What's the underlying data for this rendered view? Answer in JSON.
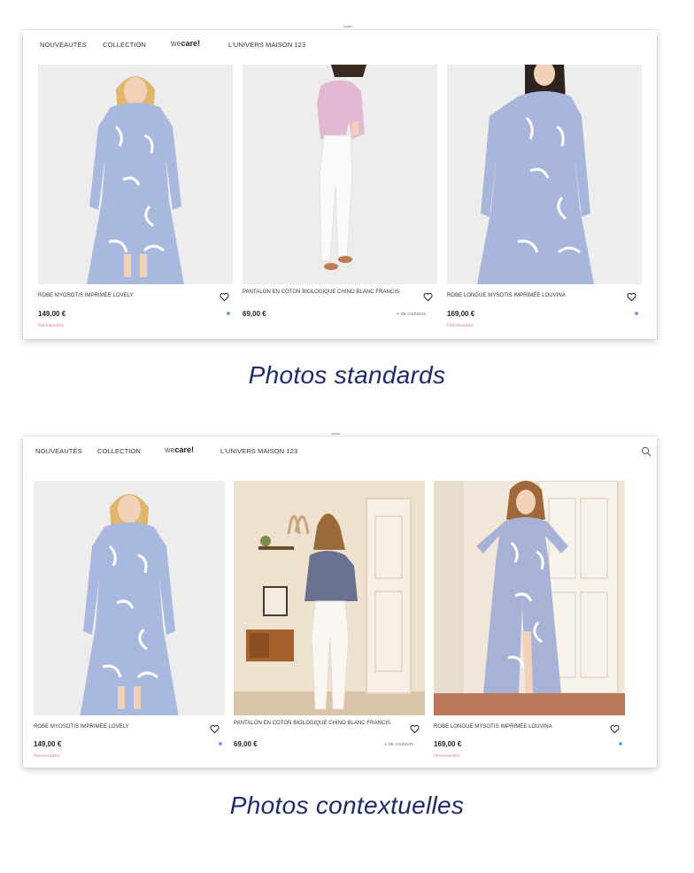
{
  "panels": [
    {
      "nav": {
        "new_label": "NOUVEAUTÉS",
        "collection_label": "COLLECTION",
        "logo_prefix": "we",
        "logo_main": "care!",
        "universe_label": "L'UNIVERS MAISON 123"
      },
      "products": [
        {
          "name": "ROBE MYOSOTIS IMPRIMÉE LOVELY",
          "price": "149,00 €",
          "badge": "Nouveautés",
          "extra": ""
        },
        {
          "name": "PANTALON EN COTON BIOLOGIQUE CHINO BLANC FRANCIS",
          "price": "69,00 €",
          "badge": "",
          "extra": "+ de couleurs"
        },
        {
          "name": "ROBE LONGUE MYSOTIS IMPRIMÉE LOUVINA",
          "price": "169,00 €",
          "badge": "Nouveautés",
          "extra": ""
        }
      ],
      "caption": "Photos standards"
    },
    {
      "nav": {
        "new_label": "NOUVEAUTÉS",
        "collection_label": "COLLECTION",
        "logo_prefix": "we",
        "logo_main": "care!",
        "universe_label": "L'UNIVERS MAISON 123"
      },
      "products": [
        {
          "name": "ROBE MYOSOTIS IMPRIMÉE LOVELY",
          "price": "149,00 €",
          "badge": "Nouveautés",
          "extra": ""
        },
        {
          "name": "PANTALON EN COTON BIOLOGIQUE CHINO BLANC FRANCIS",
          "price": "69,00 €",
          "badge": "",
          "extra": "+ de couleurs"
        },
        {
          "name": "ROBE LONGUE MYSOTIS IMPRIMÉE LOUVINA",
          "price": "169,00 €",
          "badge": "Nouveautés",
          "extra": ""
        }
      ],
      "caption": "Photos contextuelles"
    }
  ],
  "colors": {
    "caption": "#1f2a6b",
    "badge_pink": "#e48a9c",
    "color_dot": "#7e9bd8",
    "photo_studio_bg": "#ededed"
  },
  "icons": {
    "favorite": "heart-icon",
    "search": "search-icon"
  }
}
